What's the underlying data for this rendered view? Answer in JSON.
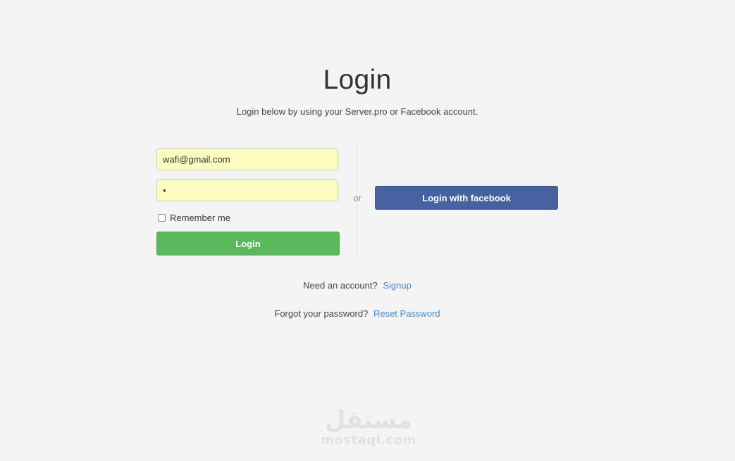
{
  "page": {
    "title": "Login",
    "subtitle": "Login below by using your Server.pro or Facebook account."
  },
  "form": {
    "email_value": "wafi@gmail.com",
    "password_value": "•",
    "remember_label": "Remember me",
    "remember_checked": false,
    "login_label": "Login"
  },
  "divider": {
    "or_label": "or"
  },
  "social": {
    "facebook_label": "Login with facebook"
  },
  "footer": {
    "signup_prompt": "Need an account?",
    "signup_link": "Signup",
    "reset_prompt": "Forgot your password?",
    "reset_link": "Reset Password"
  },
  "watermark": {
    "arabic": "مستقل",
    "latin": "mostaql.com"
  },
  "colors": {
    "background": "#f4f4f4",
    "input_autofill": "#fafdbf",
    "login_button": "#5cb85c",
    "facebook_button": "#4662a0",
    "link": "#4a86c5"
  }
}
